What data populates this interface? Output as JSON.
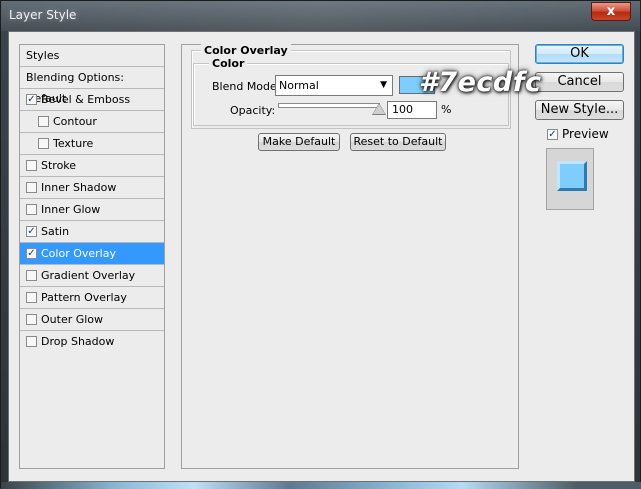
{
  "window": {
    "title": "Layer Style",
    "close_label": "x"
  },
  "styles_panel": {
    "items": [
      {
        "label": "Styles",
        "type": "header"
      },
      {
        "label": "Blending Options: Default",
        "type": "header"
      },
      {
        "label": "Bevel & Emboss",
        "checked": true,
        "indent": false
      },
      {
        "label": "Contour",
        "checked": false,
        "indent": true
      },
      {
        "label": "Texture",
        "checked": false,
        "indent": true
      },
      {
        "label": "Stroke",
        "checked": false,
        "indent": false
      },
      {
        "label": "Inner Shadow",
        "checked": false,
        "indent": false
      },
      {
        "label": "Inner Glow",
        "checked": false,
        "indent": false
      },
      {
        "label": "Satin",
        "checked": true,
        "indent": false
      },
      {
        "label": "Color Overlay",
        "checked": true,
        "indent": false,
        "selected": true
      },
      {
        "label": "Gradient Overlay",
        "checked": false,
        "indent": false
      },
      {
        "label": "Pattern Overlay",
        "checked": false,
        "indent": false
      },
      {
        "label": "Outer Glow",
        "checked": false,
        "indent": false
      },
      {
        "label": "Drop Shadow",
        "checked": false,
        "indent": false
      }
    ]
  },
  "color_overlay": {
    "section_title": "Color Overlay",
    "group_title": "Color",
    "blend_mode_label": "Blend Mode:",
    "blend_mode_value": "Normal",
    "swatch_color": "#7ecdfc",
    "opacity_label": "Opacity:",
    "opacity_value": "100",
    "opacity_unit": "%",
    "opacity_fraction": 1.0,
    "make_default_label": "Make Default",
    "reset_default_label": "Reset to Default"
  },
  "watermark": {
    "text": "#7ecdfc"
  },
  "actions": {
    "ok_label": "OK",
    "cancel_label": "Cancel",
    "new_style_label": "New Style...",
    "preview_label": "Preview",
    "preview_checked": true
  },
  "colors": {
    "selection": "#3399ff",
    "overlay": "#7ecdfc",
    "close_button": "#c9462c"
  }
}
